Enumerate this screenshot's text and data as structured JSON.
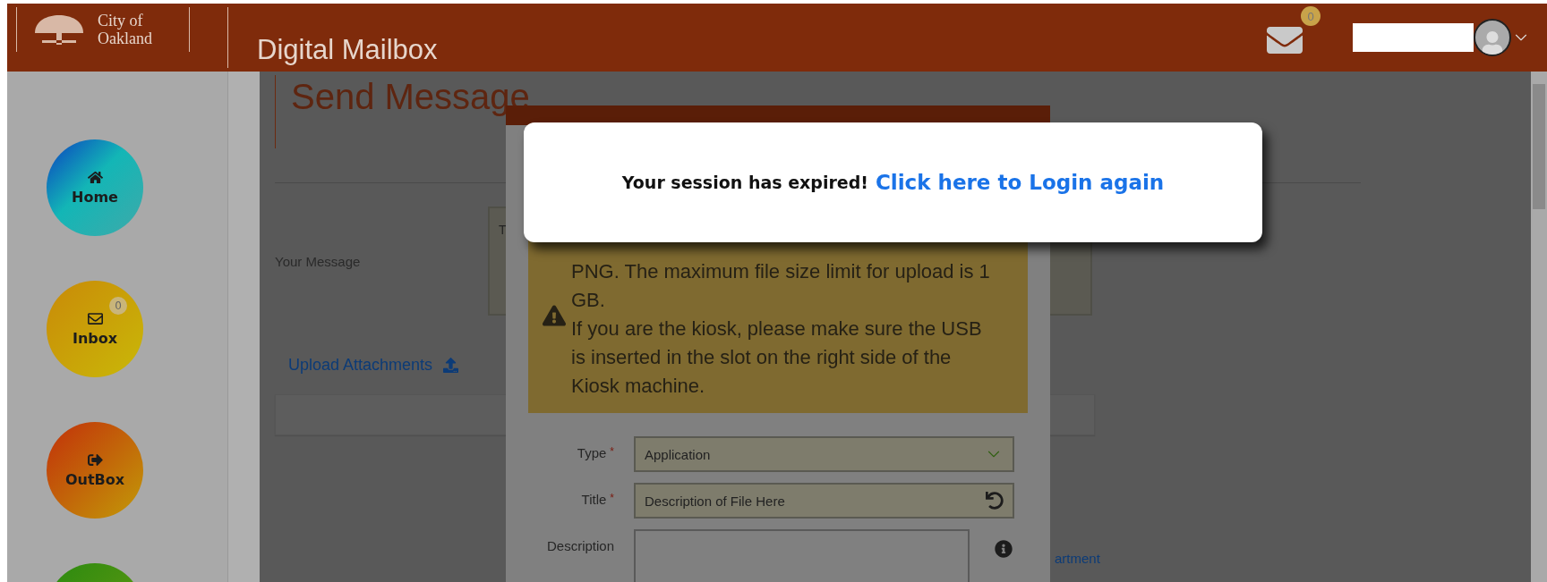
{
  "header": {
    "logo_lines": [
      "City of",
      "Oakland"
    ],
    "app_title": "Digital Mailbox",
    "mail_badge": "0"
  },
  "sidebar": {
    "items": [
      {
        "kind": "home",
        "label": "Home",
        "color": "#1aa6b8"
      },
      {
        "kind": "inbox",
        "label": "Inbox",
        "badge": "0",
        "color": "#c9a40a"
      },
      {
        "kind": "outbox",
        "label": "OutBox",
        "color": "#c25a0a"
      },
      {
        "kind": "other",
        "color": "#3d8a10"
      }
    ]
  },
  "page": {
    "title": "Send Message",
    "message_label": "Your Message",
    "message_value": "T",
    "upload_link": "Upload Attachments",
    "link_fragment": "artment"
  },
  "modal": {
    "notice": [
      "PNG. The maximum file size limit for upload is 1 GB.",
      "If you are the kiosk, please make sure the USB is inserted in the slot on the right side of the Kiosk machine."
    ],
    "fields": [
      {
        "kind": "select",
        "label": "Type",
        "required_mark": "*",
        "value": "Application"
      },
      {
        "kind": "text",
        "label": "Title",
        "required_mark": "*",
        "value": "Description of File Here"
      },
      {
        "kind": "textarea",
        "label": "Description"
      }
    ]
  },
  "session": {
    "message": "Your session has expired!",
    "link": "Click here to Login again"
  }
}
